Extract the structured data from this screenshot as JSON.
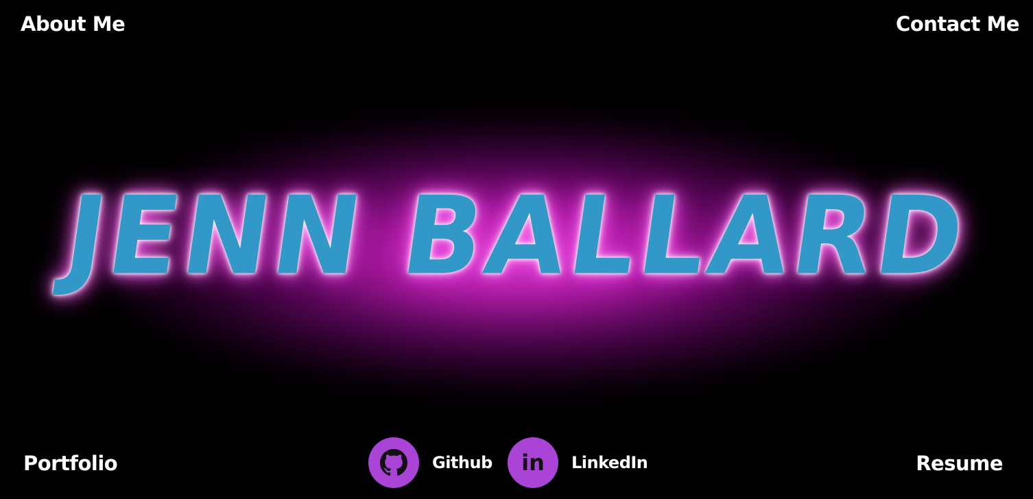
{
  "nav": {
    "about_label": "About Me",
    "contact_label": "Contact Me",
    "portfolio_label": "Portfolio",
    "resume_label": "Resume"
  },
  "hero": {
    "name": "JENN BALLARD"
  },
  "social": {
    "github": {
      "label": "Github",
      "icon": "github-icon"
    },
    "linkedin": {
      "label": "LinkedIn",
      "icon": "linkedin-icon",
      "glyph": "in"
    }
  },
  "colors": {
    "background": "#000000",
    "name_fill": "#3198c8",
    "glow": "#e030d8",
    "social_circle": "#a944d6",
    "nav_text": "#ffffff"
  }
}
